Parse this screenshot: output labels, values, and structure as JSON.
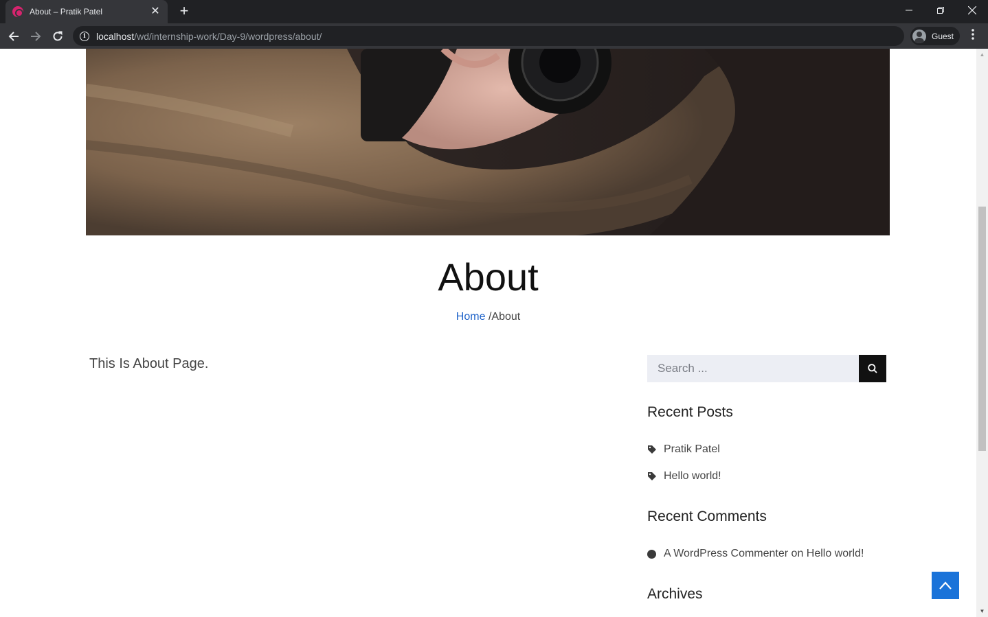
{
  "browser": {
    "tab_title": "About – Pratik Patel",
    "tab_close": "✕",
    "new_tab": "+",
    "url_host": "localhost",
    "url_path": "/wd/internship-work/Day-9/wordpress/about/",
    "profile_label": "Guest",
    "window_controls": [
      "minimize",
      "restore",
      "close"
    ]
  },
  "page": {
    "title": "About",
    "breadcrumb": {
      "home": "Home",
      "separator": "/",
      "current": "About"
    },
    "content": "This Is About Page."
  },
  "sidebar": {
    "search_placeholder": "Search ...",
    "recent_posts_title": "Recent Posts",
    "recent_posts": [
      "Pratik Patel",
      "Hello world!"
    ],
    "recent_comments_title": "Recent Comments",
    "recent_comment": {
      "author": "A WordPress Commenter",
      "connector": "on",
      "post": "Hello world!"
    },
    "archives_title": "Archives"
  },
  "colors": {
    "link": "#1f63c9",
    "back_to_top": "#1a73d9",
    "favicon": "#d6246e"
  }
}
